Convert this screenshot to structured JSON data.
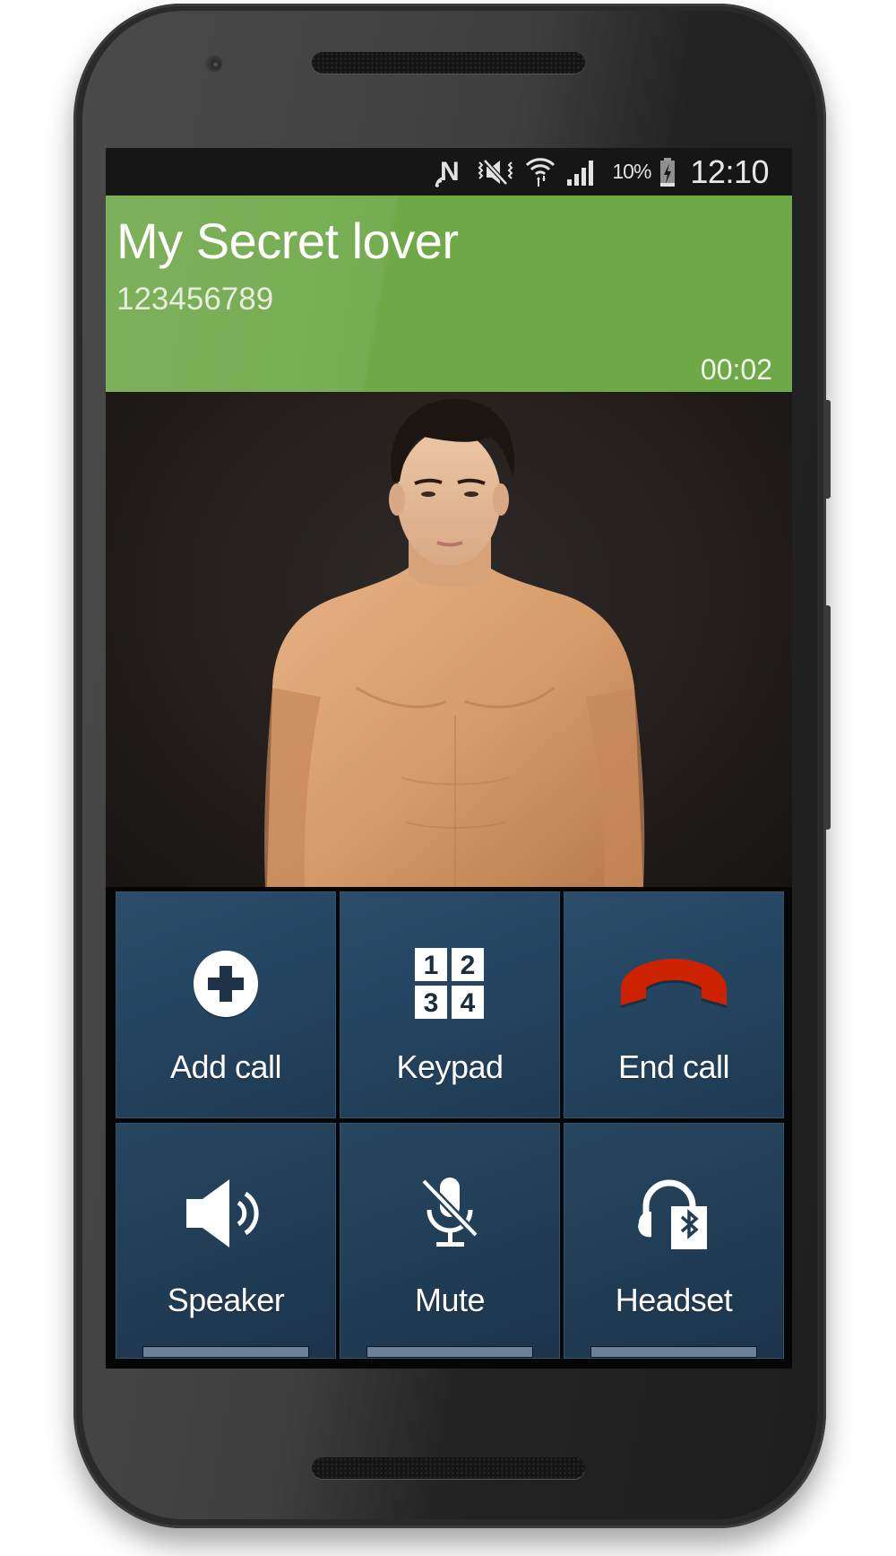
{
  "status_bar": {
    "icons": [
      "nfc-icon",
      "vibrate-mute-icon",
      "wifi-icon",
      "signal-icon",
      "battery-charging-icon"
    ],
    "battery_percent": "10%",
    "time": "12:10"
  },
  "call": {
    "caller_name": "My Secret lover",
    "caller_number": "123456789",
    "duration": "00:02",
    "header_color": "#6fa846"
  },
  "photo": {
    "description": "caller-photo"
  },
  "controls": {
    "tile_color": "#244561",
    "buttons": [
      {
        "label": "Add call",
        "icon": "add-call-icon"
      },
      {
        "label": "Keypad",
        "icon": "keypad-icon"
      },
      {
        "label": "End call",
        "icon": "end-call-icon",
        "icon_color": "#cc2200"
      },
      {
        "label": "Speaker",
        "icon": "speaker-icon",
        "active": false
      },
      {
        "label": "Mute",
        "icon": "mute-icon",
        "active": false
      },
      {
        "label": "Headset",
        "icon": "bluetooth-headset-icon",
        "active": false
      }
    ],
    "keypad_digits": [
      "1",
      "2",
      "3",
      "4"
    ]
  }
}
